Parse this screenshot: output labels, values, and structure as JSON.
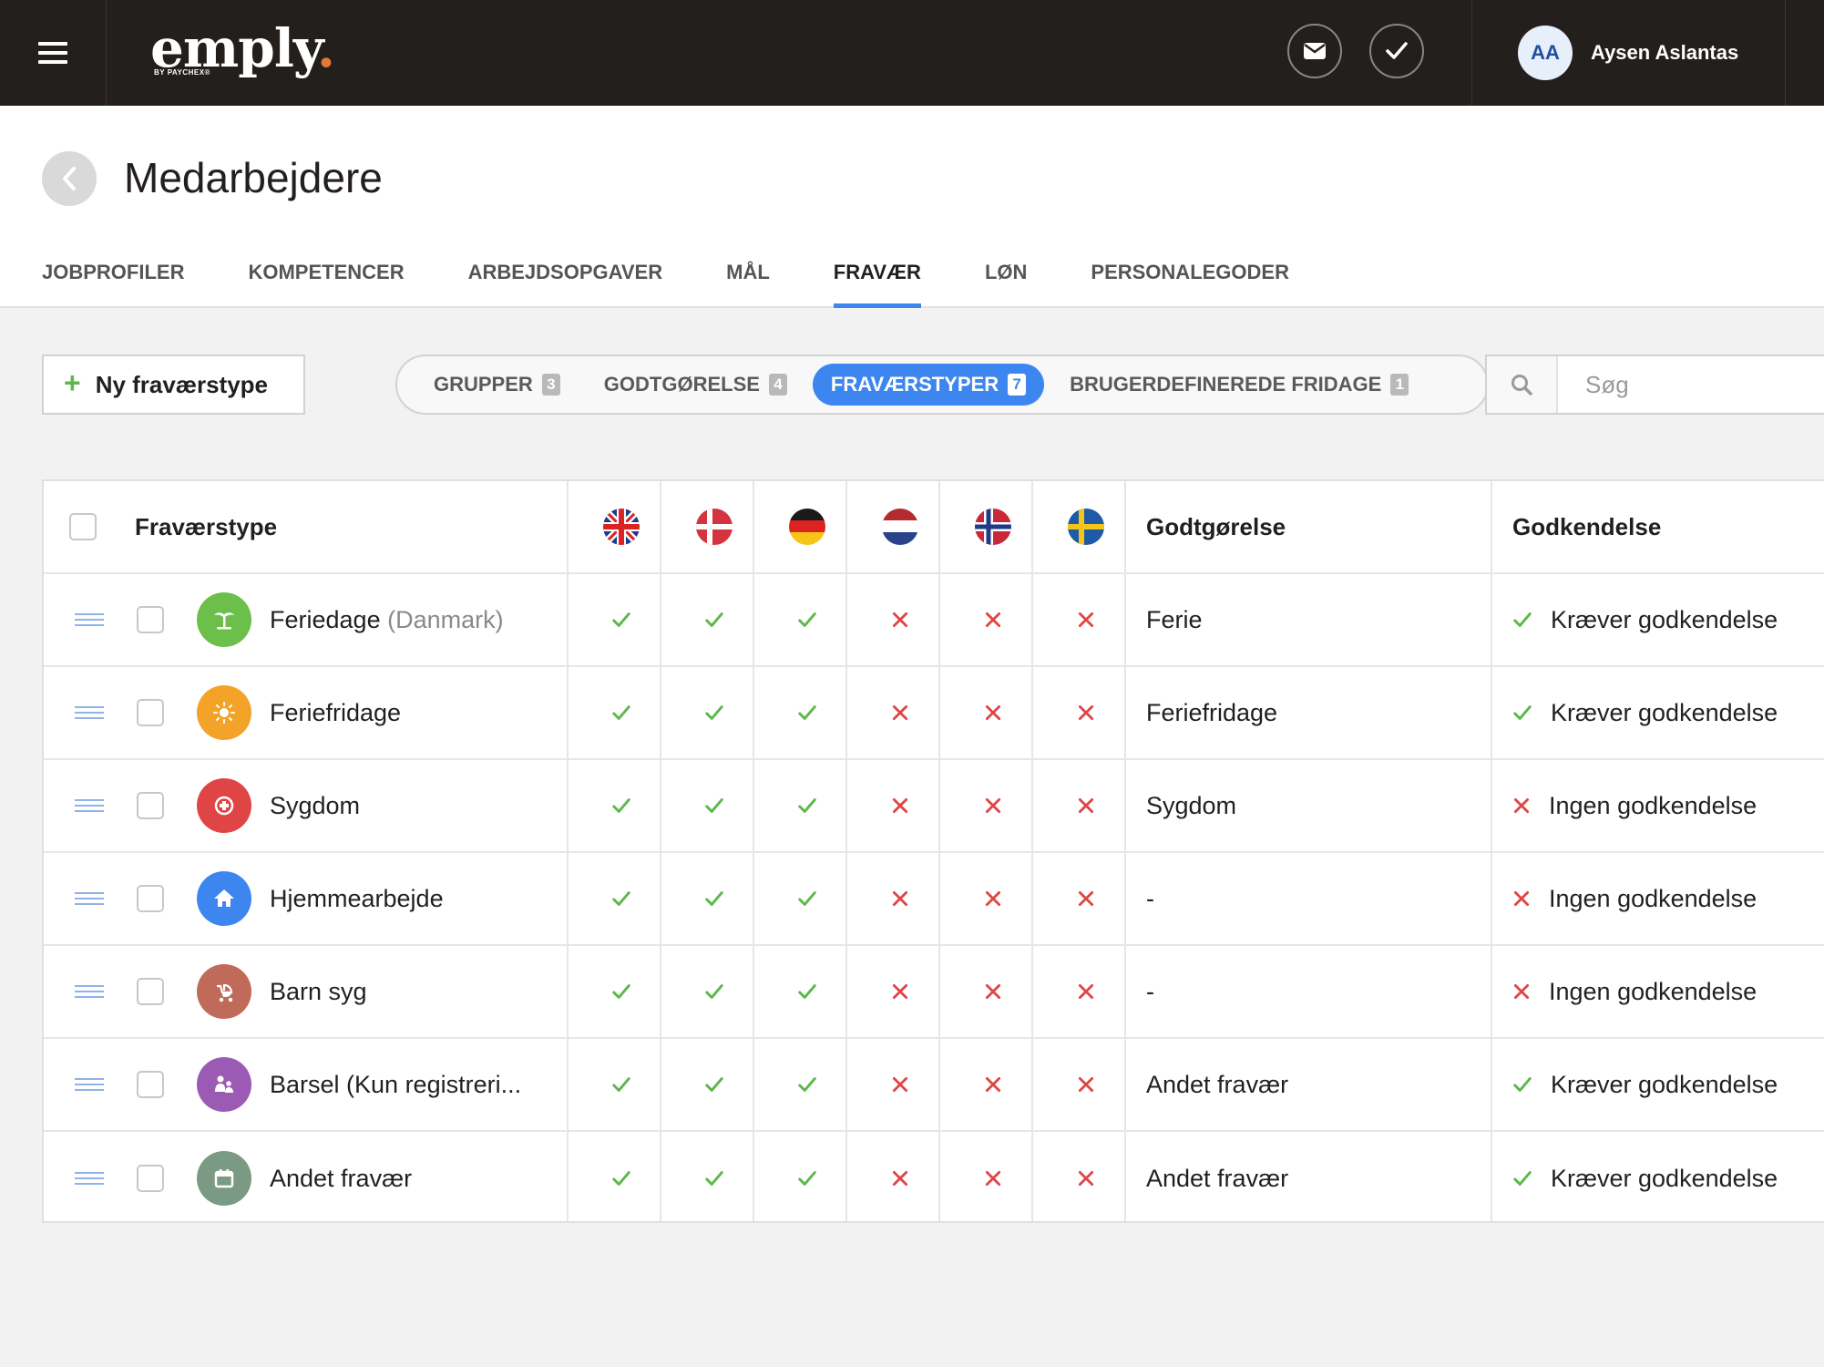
{
  "topbar": {
    "logo_text": "emply",
    "logo_dot": ".",
    "logo_sub": "BY PAYCHEX®",
    "user_initials": "AA",
    "user_name": "Aysen Aslantas"
  },
  "header": {
    "title": "Medarbejdere",
    "tabs": [
      "JOBPROFILER",
      "KOMPETENCER",
      "ARBEJDSOPGAVER",
      "MÅL",
      "FRAVÆR",
      "LØN",
      "PERSONALEGODER"
    ],
    "active_tab": "FRAVÆR"
  },
  "toolbar": {
    "new_button": "Ny fraværstype",
    "segments": [
      {
        "label": "GRUPPER",
        "count": "3"
      },
      {
        "label": "GODTGØRELSE",
        "count": "4"
      },
      {
        "label": "FRAVÆRSTYPER",
        "count": "7"
      },
      {
        "label": "BRUGERDEFINEREDE FRIDAGE",
        "count": "1"
      }
    ],
    "active_segment": "FRAVÆRSTYPER",
    "search_placeholder": "Søg"
  },
  "colors": {
    "accent": "#3d86f0",
    "check": "#5db84a",
    "cross": "#e04545",
    "topbar": "#231f1c"
  },
  "table": {
    "headers": {
      "type": "Fraværstype",
      "compensation": "Godtgørelse",
      "approval": "Godkendelse"
    },
    "flags": [
      "uk-flag-icon",
      "denmark-flag-icon",
      "germany-flag-icon",
      "netherlands-flag-icon",
      "norway-flag-icon",
      "sweden-flag-icon"
    ],
    "rows": [
      {
        "name": "Feriedage",
        "suffix": "(Danmark)",
        "icon": "palm-tree-icon",
        "icon_color": "#6cbf4b",
        "flags": [
          true,
          true,
          true,
          false,
          false,
          false
        ],
        "compensation": "Ferie",
        "approval_required": true,
        "approval": "Kræver godkendelse"
      },
      {
        "name": "Feriefridage",
        "suffix": "",
        "icon": "sun-icon",
        "icon_color": "#f2a328",
        "flags": [
          true,
          true,
          true,
          false,
          false,
          false
        ],
        "compensation": "Feriefridage",
        "approval_required": true,
        "approval": "Kræver godkendelse"
      },
      {
        "name": "Sygdom",
        "suffix": "",
        "icon": "medical-cross-icon",
        "icon_color": "#e04545",
        "flags": [
          true,
          true,
          true,
          false,
          false,
          false
        ],
        "compensation": "Sygdom",
        "approval_required": false,
        "approval": "Ingen godkendelse"
      },
      {
        "name": "Hjemmearbejde",
        "suffix": "",
        "icon": "home-icon",
        "icon_color": "#3d86f0",
        "flags": [
          true,
          true,
          true,
          false,
          false,
          false
        ],
        "compensation": "-",
        "approval_required": false,
        "approval": "Ingen godkendelse"
      },
      {
        "name": "Barn syg",
        "suffix": "",
        "icon": "stroller-icon",
        "icon_color": "#c06a5a",
        "flags": [
          true,
          true,
          true,
          false,
          false,
          false
        ],
        "compensation": "-",
        "approval_required": false,
        "approval": "Ingen godkendelse"
      },
      {
        "name": "Barsel (Kun registreri...",
        "suffix": "",
        "icon": "parents-icon",
        "icon_color": "#9b5bb5",
        "flags": [
          true,
          true,
          true,
          false,
          false,
          false
        ],
        "compensation": "Andet fravær",
        "approval_required": true,
        "approval": "Kræver godkendelse"
      },
      {
        "name": "Andet fravær",
        "suffix": "",
        "icon": "calendar-icon",
        "icon_color": "#7a9a84",
        "flags": [
          true,
          true,
          true,
          false,
          false,
          false
        ],
        "compensation": "Andet fravær",
        "approval_required": true,
        "approval": "Kræver godkendelse"
      }
    ]
  }
}
